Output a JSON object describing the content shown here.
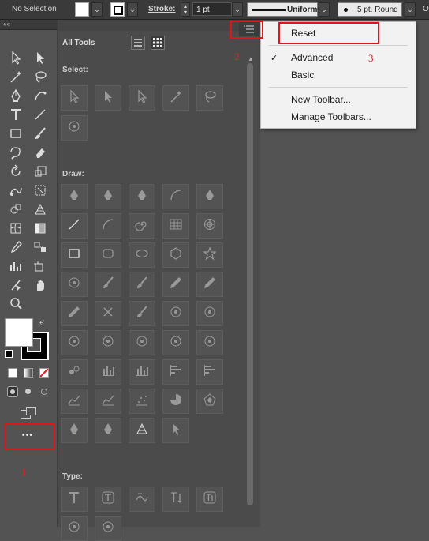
{
  "control_bar": {
    "selection_label": "No Selection",
    "stroke_label": "Stroke:",
    "stroke_weight": "1 pt",
    "stroke_profile": "Uniform",
    "brush_label": "5 pt. Round",
    "cut_letter": "O"
  },
  "toolbar": {
    "collapse_label": "««",
    "more_tools_label": "•••"
  },
  "drawer": {
    "title": "All Tools",
    "sections": {
      "select": "Select:",
      "draw": "Draw:",
      "type": "Type:"
    }
  },
  "menu": {
    "items": [
      {
        "label": "Reset"
      },
      {
        "label": "Advanced",
        "checked": true
      },
      {
        "label": "Basic"
      },
      {
        "label": "New Toolbar..."
      },
      {
        "label": "Manage Toolbars..."
      }
    ],
    "check_mark": "✓"
  },
  "annotations": {
    "one": "1",
    "two": "2",
    "three": "3",
    "color": "#e0141b"
  }
}
